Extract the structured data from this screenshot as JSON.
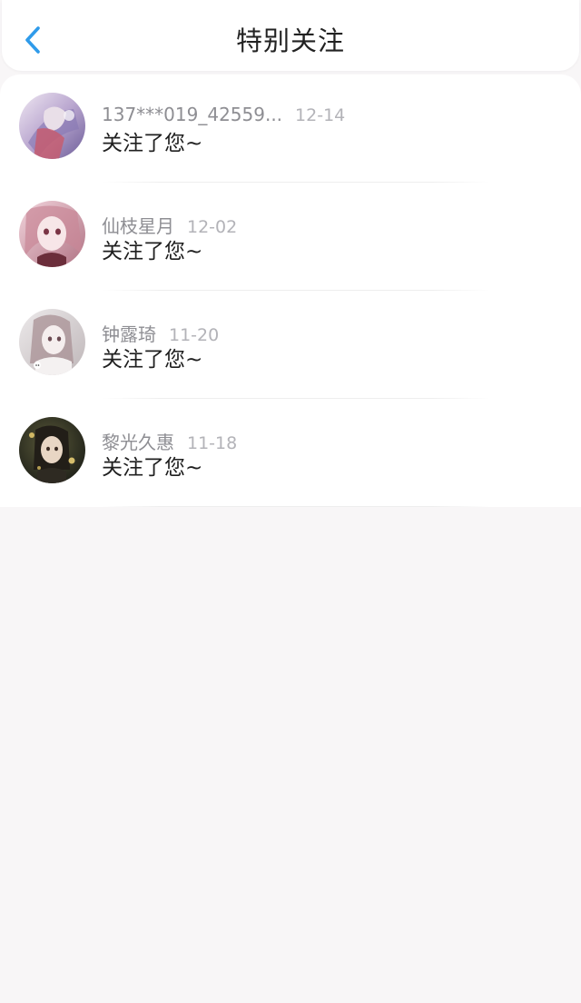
{
  "header": {
    "title": "特别关注",
    "back_icon": "chevron-left-icon",
    "accent": "#2f9bea"
  },
  "items": [
    {
      "name": "137***019_42559...",
      "date": "12-14",
      "message": "关注了您~"
    },
    {
      "name": "仙枝星月",
      "date": "12-02",
      "message": "关注了您~"
    },
    {
      "name": "钟露琦",
      "date": "11-20",
      "message": "关注了您~"
    },
    {
      "name": "黎光久惠",
      "date": "11-18",
      "message": "关注了您~"
    }
  ]
}
